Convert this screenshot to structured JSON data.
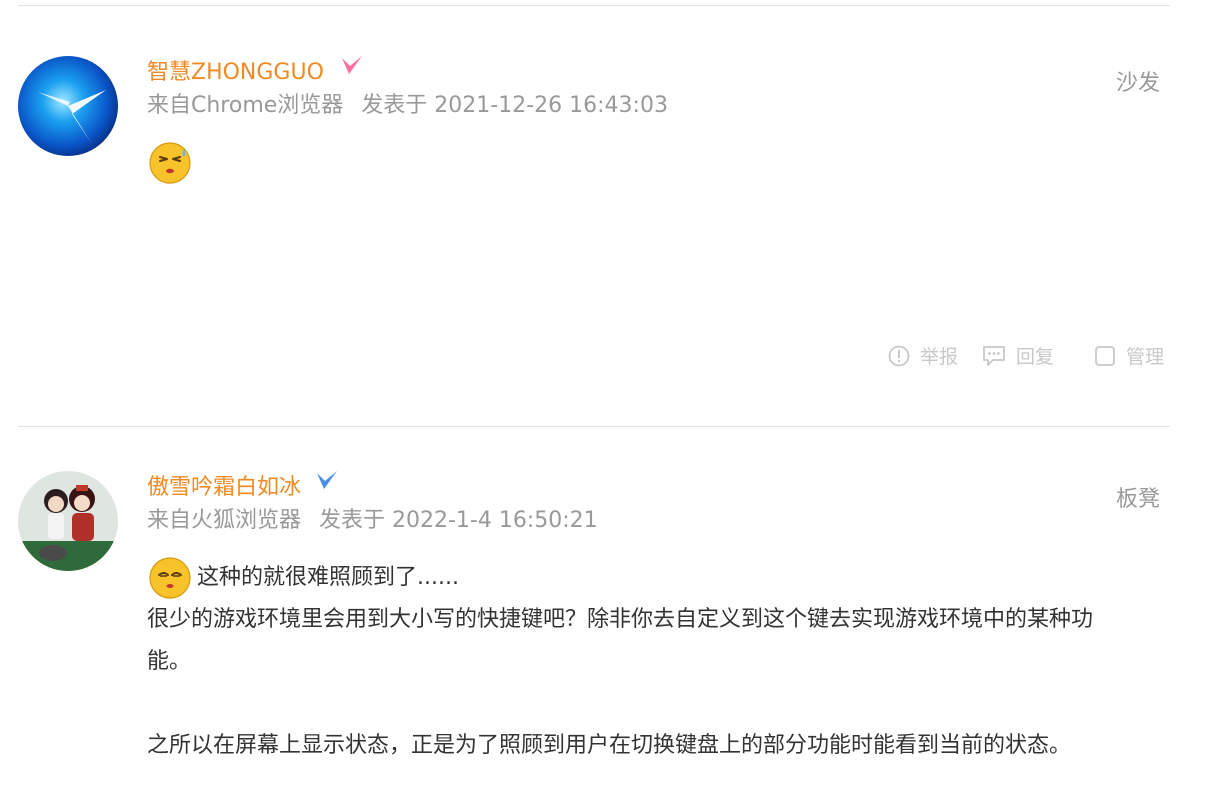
{
  "posts": [
    {
      "author": "智慧ZHONGGUO",
      "source": "来自Chrome浏览器",
      "posted": "发表于 2021-12-26 16:43:03",
      "floor": "沙发",
      "emoji": "sweat-face-emoji",
      "badge_color": "#ff6f9a"
    },
    {
      "author": "傲雪吟霜白如冰",
      "source": "来自火狐浏览器",
      "posted": "发表于 2022-1-4 16:50:21",
      "floor": "板凳",
      "emoji": "sleepy-face-emoji",
      "badge_color": "#4a90e2",
      "first_line": "这种的就很难照顾到了......",
      "para1_line1": "很少的游戏环境里会用到大小写的快捷键吧？除非你去自定义到这个键去实现游戏环境中的某种功",
      "para1_line2": "能。",
      "para2": "之所以在屏幕上显示状态，正是为了照顾到用户在切换键盘上的部分功能时能看到当前的状态。"
    }
  ],
  "actions": {
    "report": "举报",
    "reply": "回复",
    "manage": "管理"
  },
  "colors": {
    "author": "#f08a24",
    "meta": "#999999",
    "action": "#c8c8c8"
  }
}
